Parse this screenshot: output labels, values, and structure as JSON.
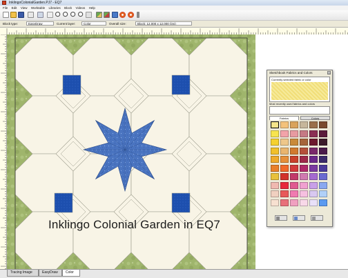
{
  "window": {
    "title": "InklingoColonialGarden.PJ7 - EQ7"
  },
  "menu": [
    "File",
    "Edit",
    "View",
    "Worktable",
    "Libraries",
    "Block",
    "Videos",
    "Help"
  ],
  "toolbar": {
    "icons": [
      "new-file-icon",
      "open-folder-icon",
      "save-icon",
      "print-icon",
      "undo-icon",
      "redo-icon",
      "zoom-in-icon",
      "zoom-out-icon",
      "zoom-fit-icon",
      "zoom-actual-icon",
      "refresh-icon",
      "add-to-sketchbook-icon",
      "view-sketchbook-icon",
      "worktable-icon",
      "color-wheel-icon",
      "more-icon"
    ]
  },
  "status": {
    "block_type_label": "Block type:",
    "block_type_value": "EasyDraw",
    "current_layer_label": "Current layer:",
    "current_layer_value": "Color",
    "overall_size_label": "Overall size:",
    "overall_size_value": "Block: 12.000 x 12.000 (ins)"
  },
  "caption": "Inklingo Colonial Garden in EQ7",
  "tabs": [
    "Tracing Image",
    "EasyDraw",
    "Color"
  ],
  "active_tab": "Color",
  "palette": {
    "title": "Sketchbook Fabrics and Colors",
    "current_label": "Currently selected fabric or color",
    "recent_label": "Most recently used fabrics and colors",
    "tab_fabrics": "Fabrics",
    "tab_colors": "Colors",
    "swatch_colors": [
      [
        "#f4e48a",
        "#f3c27a",
        "#d9a35a",
        "#c6b69a",
        "#9a6f4a",
        "#7a4a2e"
      ],
      [
        "#f7e44f",
        "#f2a3a9",
        "#e79aa0",
        "#c57a84",
        "#8b2f54",
        "#5b1a3a"
      ],
      [
        "#f5d12f",
        "#eec78a",
        "#c98a3a",
        "#a6643a",
        "#6d1a2e",
        "#3c1a2a"
      ],
      [
        "#f1c02a",
        "#e9b56e",
        "#d17a2e",
        "#b5503a",
        "#7a2a6a",
        "#4a1a4a"
      ],
      [
        "#efaa2a",
        "#e58f3a",
        "#c9402a",
        "#9f2a4a",
        "#6b2a8a",
        "#3a2a6a"
      ],
      [
        "#e9802a",
        "#f06a2a",
        "#d23a3a",
        "#b02a6a",
        "#7a3aa0",
        "#4a3a9a"
      ],
      [
        "#e8c13a",
        "#d2322a",
        "#c23a6a",
        "#d07ab0",
        "#a46ad0",
        "#6a6ad0"
      ],
      [
        "#f0b8b0",
        "#e8283a",
        "#e05a90",
        "#f0a0d0",
        "#c8a0e8",
        "#8aa8f0"
      ],
      [
        "#f0d0c0",
        "#e85a5a",
        "#f07ab0",
        "#f6c0e0",
        "#d8c8f0",
        "#b0d0f8"
      ],
      [
        "#f7e0d0",
        "#e8707a",
        "#f0a0c0",
        "#f8d8e8",
        "#e8e0f8",
        "#5a9af0"
      ]
    ]
  }
}
